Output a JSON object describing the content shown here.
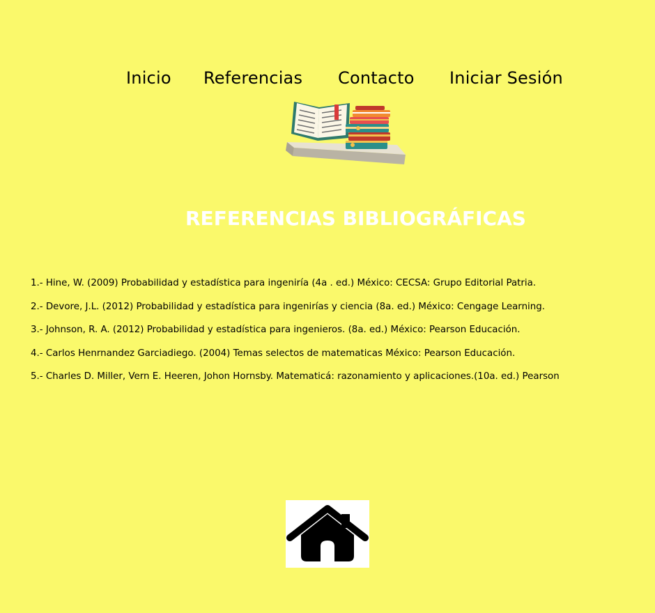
{
  "nav": {
    "items": [
      {
        "label": "Inicio"
      },
      {
        "label": "Referencias"
      },
      {
        "label": "Contacto"
      },
      {
        "label": "Iniciar Sesión"
      }
    ]
  },
  "header_image": {
    "icon": "books-icon"
  },
  "page_title": "REFERENCIAS BIBLIOGRÁFICAS",
  "references": [
    "1.- Hine, W. (2009) Probabilidad y estadística para ingeniría (4a . ed.) México: CECSA: Grupo Editorial Patria.",
    "2.- Devore, J.L. (2012) Probabilidad y estadística para ingenirías y ciencia (8a. ed.) México: Cengage Learning.",
    "3.- Johnson, R. A. (2012) Probabilidad y estadística para ingenieros. (8a. ed.) México: Pearson Educación.",
    "4.- Carlos Henrnandez Garciadiego. (2004) Temas selectos de matematicas México: Pearson Educación.",
    "5.- Charles D. Miller, Vern E. Heeren, Johon Hornsby. Matematicá: razonamiento y aplicaciones.(10a. ed.) Pearson"
  ],
  "home_button": {
    "icon": "home-icon"
  },
  "colors": {
    "background": "#faf96b",
    "title": "#ffffff",
    "text": "#000000"
  }
}
